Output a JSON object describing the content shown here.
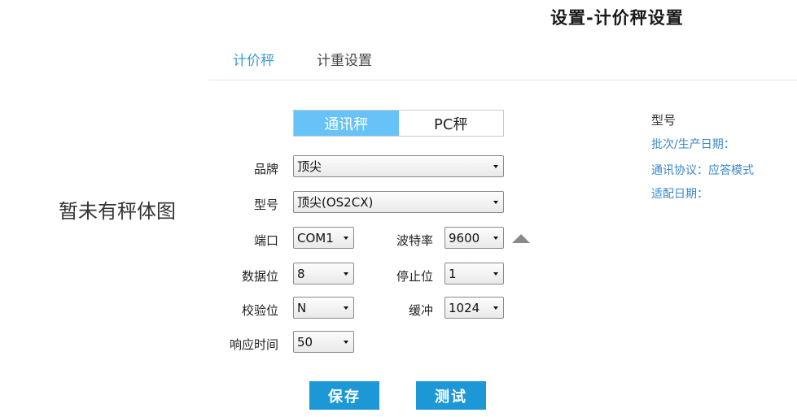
{
  "header": {
    "title": "设置-计价秤设置"
  },
  "tabs": [
    {
      "label": "计价秤",
      "active": true
    },
    {
      "label": "计重设置",
      "active": false
    }
  ],
  "left_panel": {
    "placeholder": "暂未有秤体图"
  },
  "mode_toggle": {
    "options": [
      "通讯秤",
      "PC秤"
    ],
    "selected": "通讯秤"
  },
  "form": {
    "brand": {
      "label": "品牌",
      "value": "顶尖"
    },
    "model": {
      "label": "型号",
      "value": "顶尖(OS2CX)"
    },
    "port": {
      "label": "端口",
      "value": "COM1"
    },
    "baud": {
      "label": "波特率",
      "value": "9600"
    },
    "databits": {
      "label": "数据位",
      "value": "8"
    },
    "stopbits": {
      "label": "停止位",
      "value": "1"
    },
    "parity": {
      "label": "校验位",
      "value": "N"
    },
    "buffer": {
      "label": "缓冲",
      "value": "1024"
    },
    "timeout": {
      "label": "响应时间",
      "value": "50"
    }
  },
  "actions": {
    "save_label": "保存",
    "test_label": "测试"
  },
  "info_panel": {
    "model_label": "型号",
    "batch_label": "批次/生产日期：",
    "protocol_label": "通讯协议：应答模式",
    "adapt_label": "适配日期："
  },
  "colors": {
    "accent": "#3a9ad9",
    "toggle_active": "#66c2f7",
    "button": "#1c98d6",
    "info_text": "#3a87c8"
  }
}
